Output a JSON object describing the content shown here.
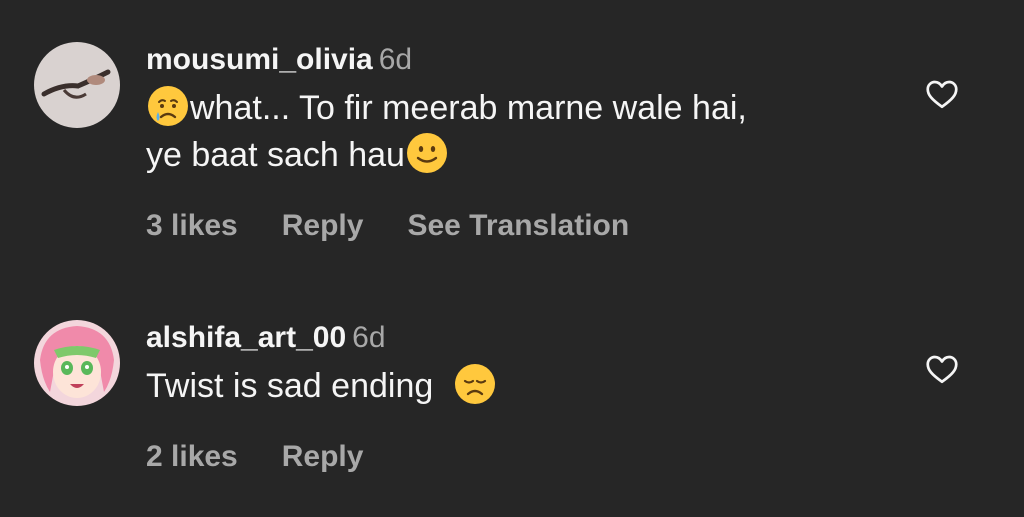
{
  "comments": [
    {
      "username": "mousumi_olivia",
      "time": "6d",
      "emoji_lead": "crying-face",
      "text_line1": "what... To fir meerab marne wale hai,",
      "text_line2": "ye baat sach hau",
      "emoji_trail": "slightly-smiling-face",
      "likes": "3 likes",
      "reply": "Reply",
      "translate": "See Translation",
      "avatar_icon": "hands-photo-avatar",
      "heart_icon": "heart-outline-icon"
    },
    {
      "username": "alshifa_art_00",
      "time": "6d",
      "text": "Twist is sad ending",
      "emoji_trail": "disappointed-face",
      "likes": "2 likes",
      "reply": "Reply",
      "avatar_icon": "anime-character-avatar",
      "heart_icon": "heart-outline-icon"
    }
  ],
  "colors": {
    "background": "#262626",
    "primary_text": "#f5f5f5",
    "secondary_text": "#a8a8a8",
    "emoji_yellow": "#ffc83d"
  }
}
